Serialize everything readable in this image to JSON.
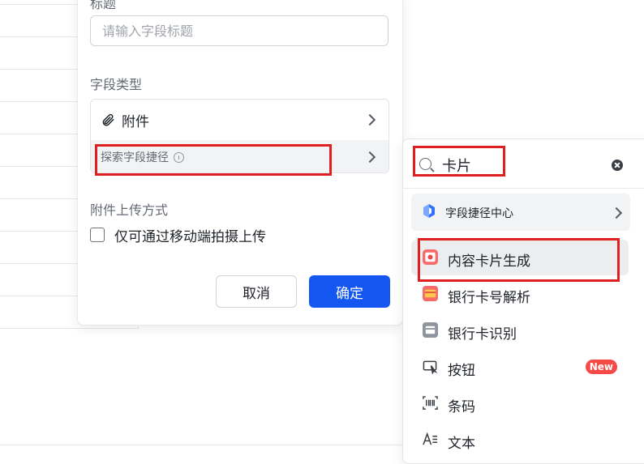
{
  "dialog": {
    "title_label": "标题",
    "title_placeholder": "请输入字段标题",
    "field_type_label": "字段类型",
    "field_type_value": "附件",
    "explore_shortcut_label": "探索字段捷径",
    "upload_mode_label": "附件上传方式",
    "mobile_only_label": "仅可通过移动端拍摄上传",
    "cancel_label": "取消",
    "confirm_label": "确定"
  },
  "shortcut_panel": {
    "search_value": "卡片",
    "center_label": "字段捷径中心",
    "items": [
      {
        "label": "内容卡片生成",
        "icon": "camera-icon"
      },
      {
        "label": "银行卡号解析",
        "icon": "bank-card-icon"
      },
      {
        "label": "银行卡识别",
        "icon": "card-scan-icon"
      },
      {
        "label": "按钮",
        "icon": "button-icon",
        "badge": "New"
      },
      {
        "label": "条码",
        "icon": "barcode-icon"
      },
      {
        "label": "文本",
        "icon": "text-icon"
      }
    ]
  },
  "colors": {
    "primary": "#1456f0",
    "highlight_box": "#e02020",
    "new_badge": "#f54a45"
  }
}
